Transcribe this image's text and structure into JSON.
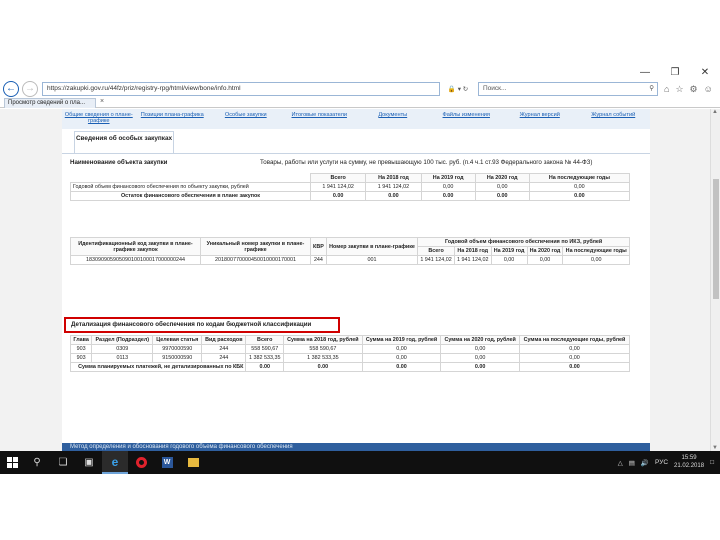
{
  "browser": {
    "url": "https://zakupki.gov.ru/44fz/priz/registry-rpg/html/view/bone/info.html",
    "search_placeholder": "Поиск...",
    "tab_title": "Просмотр сведений о пла...",
    "window_controls": [
      "—",
      "❐",
      "✕"
    ]
  },
  "nav": {
    "links": [
      "Общие сведения о плане-графике",
      "Позиции плана-графика",
      "Особые закупки",
      "Итоговые показатели",
      "Документы",
      "Файлы изменения",
      "Журнал версий",
      "Журнал событий"
    ],
    "active_tab": "Сведения об особых закупках"
  },
  "purchase_object": {
    "label": "Наименование объекта закупки",
    "value": "Товары, работы или услуги на сумму, не превышающую 100 тыс. руб. (п.4 ч.1 ст.93 Федерального закона № 44-ФЗ)"
  },
  "totals_table": {
    "headers": [
      "Всего",
      "На 2018 год",
      "На 2019 год",
      "На 2020 год",
      "На последующие годы"
    ],
    "rows": [
      {
        "label": "Годовой объем финансового обеспечения по объекту закупки, рублей",
        "values": [
          "1 941 124,02",
          "1 941 124,02",
          "0,00",
          "0,00",
          "0,00"
        ]
      },
      {
        "label": "Остаток финансового обеспечения в плане закупок",
        "values": [
          "0.00",
          "0.00",
          "0.00",
          "0.00",
          "0.00"
        ]
      }
    ]
  },
  "ikz_table": {
    "headers": [
      "Идентификационный код закупки в плане-графике закупок",
      "Уникальный номер закупки в плане-графике",
      "КВР",
      "Номер закупки в плане-графике",
      "Годовой объем финансового обеспечения по ИКЗ, рублей"
    ],
    "subheaders": [
      "Всего",
      "На 2018 год",
      "На 2019 год",
      "На 2020 год",
      "На последующие годы"
    ],
    "row": [
      "183090905905090100100017000000244",
      "201800770000450010000170001",
      "244",
      "001",
      "1 941 124,02",
      "1 941 124,02",
      "0,00",
      "0,00",
      "0,00"
    ]
  },
  "detail_label": "Детализация финансового обеспечения по кодам бюджетной классификации",
  "kbk_table": {
    "headers": [
      "Глава",
      "Раздел (Подраздел)",
      "Целевая статья",
      "Вид расходов",
      "Всего",
      "Сумма на 2018 год, рублей",
      "Сумма на 2019 год, рублей",
      "Сумма на 2020 год, рублей",
      "Сумма на последующие годы, рублей"
    ],
    "rows": [
      [
        "903",
        "0309",
        "9970000590",
        "244",
        "558 590,67",
        "558 590,67",
        "0,00",
        "0,00",
        "0,00"
      ],
      [
        "903",
        "0113",
        "9150000590",
        "244",
        "1 382 533,35",
        "1 382 533,35",
        "0,00",
        "0,00",
        "0,00"
      ]
    ],
    "summary_label": "Сумма планируемых платежей, не детализированных по КБК",
    "summary_values": [
      "0.00",
      "0.00",
      "0.00",
      "0.00",
      "0.00"
    ]
  },
  "footer_band": "Метод определения и обоснования годового объема финансового обеспечения",
  "taskbar": {
    "clock_time": "15:59",
    "clock_date": "21.02.2018",
    "lang": "РУС"
  }
}
